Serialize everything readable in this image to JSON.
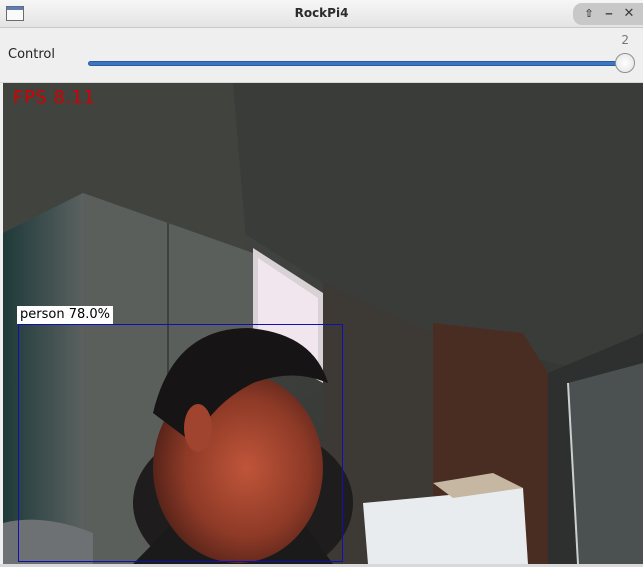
{
  "window": {
    "title": "RockPi4",
    "icons": {
      "app": "window-app-icon",
      "up": "arrow-up-icon",
      "minimize": "minimize-icon",
      "close": "close-icon"
    }
  },
  "control": {
    "label": "Control",
    "value": "2",
    "slider_fraction": 1.0
  },
  "video": {
    "fps_text": "FPS 8.11",
    "detection": {
      "label": "person 78.0%",
      "box_color": "#1010b0"
    },
    "fps_color": "#d40000"
  }
}
